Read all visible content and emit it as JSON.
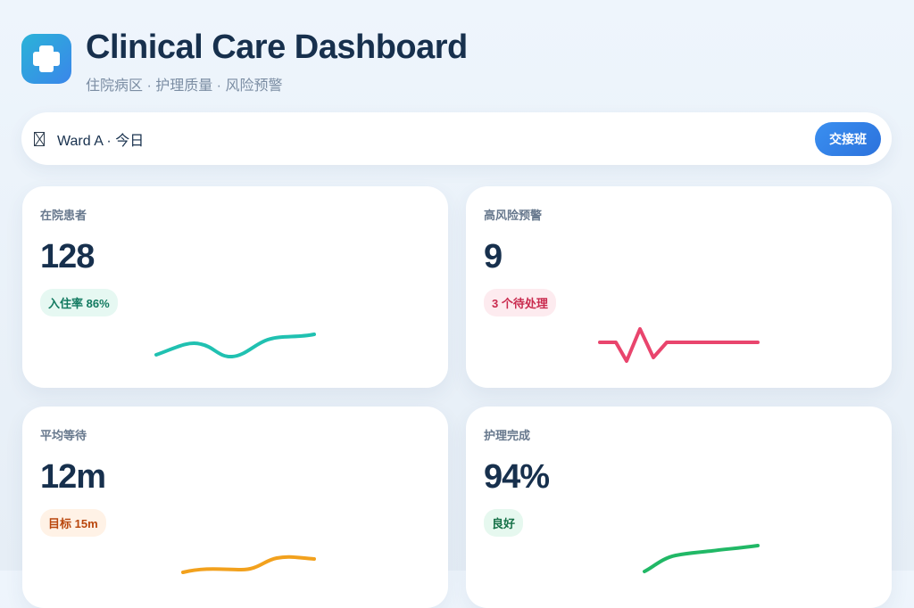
{
  "header": {
    "title": "Clinical Care Dashboard",
    "subtitle": "住院病区 · 护理质量 · 风险预警",
    "logo_icon": "medical-cross-icon"
  },
  "search": {
    "icon": "search-icon",
    "text": "Ward A · 今日",
    "button_label": "交接班"
  },
  "cards": [
    {
      "label": "在院患者",
      "value": "128",
      "badge": "入住率 86%",
      "badge_color": "#127a60",
      "badge_bg": "#e6f8f2",
      "line_color": "#20c1b1"
    },
    {
      "label": "高风险预警",
      "value": "9",
      "badge": "3 个待处理",
      "badge_color": "#c92a4e",
      "badge_bg": "#fdebef",
      "line_color": "#e9456d"
    },
    {
      "label": "平均等待",
      "value": "12m",
      "badge": "目标 15m",
      "badge_color": "#b9470d",
      "badge_bg": "#fff2e6",
      "line_color": "#f2a11d"
    },
    {
      "label": "护理完成",
      "value": "94%",
      "badge": "良好",
      "badge_color": "#157047",
      "badge_bg": "#e6f8ef",
      "line_color": "#21b866"
    }
  ]
}
